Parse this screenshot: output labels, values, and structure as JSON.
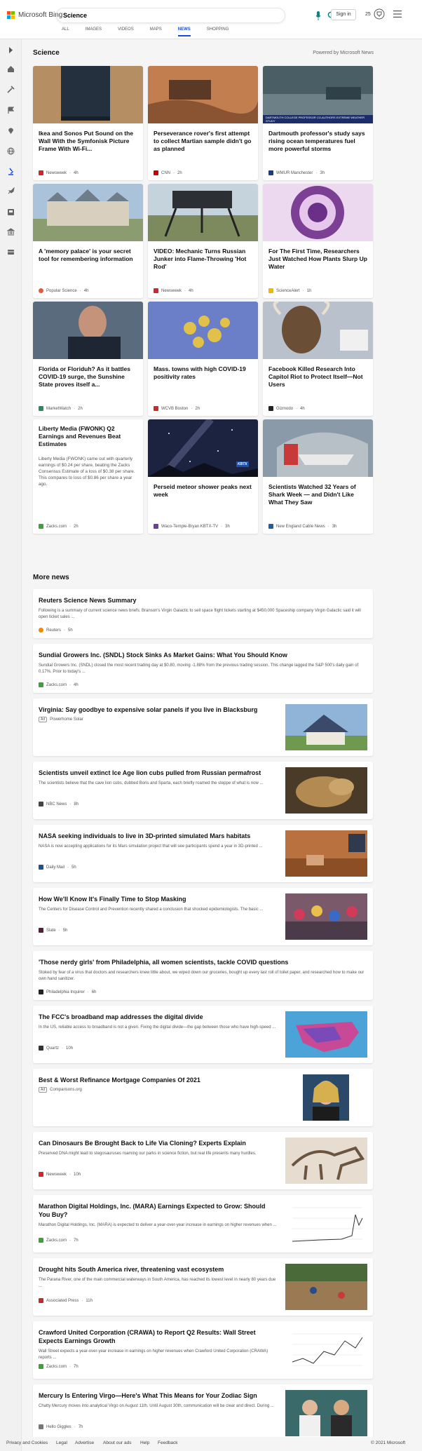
{
  "header": {
    "brand": "Microsoft Bing",
    "query": "Science",
    "tabs": [
      {
        "label": "ALL",
        "active": false
      },
      {
        "label": "IMAGES",
        "active": false
      },
      {
        "label": "VIDEOS",
        "active": false
      },
      {
        "label": "MAPS",
        "active": false
      },
      {
        "label": "NEWS",
        "active": true
      },
      {
        "label": "SHOPPING",
        "active": false
      }
    ],
    "signin_label": "Sign in",
    "rewards_count": "25"
  },
  "science": {
    "heading": "Science",
    "powered_by": "Powered by Microsoft News",
    "cards": [
      {
        "title": "Ikea and Sonos Put Sound on the Wall With the Symfonisk Picture Frame With Wi-Fi...",
        "source": "Newsweek",
        "age": "4h"
      },
      {
        "title": "Perseverance rover's first attempt to collect Martian sample didn't go as planned",
        "source": "CNN",
        "age": "2h"
      },
      {
        "title": "Dartmouth professor's study says rising ocean temperatures fuel more powerful storms",
        "source": "WMUR Manchester",
        "age": "3h",
        "image_caption": "DARTMOUTH COLLEGE PROFESSOR CO-AUTHORS EXTREME WEATHER STUDY"
      },
      {
        "title": "A 'memory palace' is your secret tool for remembering information",
        "source": "Popular Science",
        "age": "4h"
      },
      {
        "title": "VIDEO: Mechanic Turns Russian Junker into Flame-Throwing 'Hot Rod'",
        "source": "Newsweek",
        "age": "4h"
      },
      {
        "title": "For The First Time, Researchers Just Watched How Plants Slurp Up Water",
        "source": "ScienceAlert",
        "age": "1h"
      },
      {
        "title": "Florida or Floriduh? As it battles COVID-19 surge, the Sunshine State proves itself a...",
        "source": "MarketWatch",
        "age": "2h"
      },
      {
        "title": "Mass. towns with high COVID-19 positivity rates",
        "source": "WCVB Boston",
        "age": "2h"
      },
      {
        "title": "Facebook Killed Research Into Capitol Riot to Protect Itself—Not Users",
        "source": "Gizmodo",
        "age": "4h"
      },
      {
        "title": "Liberty Media (FWONK) Q2 Earnings and Revenues Beat Estimates",
        "source": "Zacks.com",
        "age": "2h",
        "body": "Liberty Media (FWONK) came out with quarterly earnings of $0.24 per share, beating the Zacks Consensus Estimate of a loss of $0.38 per share. This compares to loss of $0.86 per share a year ago."
      },
      {
        "title": "Perseid meteor shower peaks next week",
        "source": "Waco-Temple-Bryan KBTX-TV",
        "age": "3h",
        "image_caption": "KBTX"
      },
      {
        "title": "Scientists Watched 32 Years of Shark Week — and Didn't Like What They Saw",
        "source": "New England Cable News",
        "age": "3h"
      }
    ]
  },
  "more_news": {
    "heading": "More news",
    "items": [
      {
        "title": "Reuters Science News Summary",
        "body": "Following is a summary of current science news briefs. Branson's Virgin Galactic to sell space flight tickets starting at $450,000 Spaceship company Virgin Galactic said it will open ticket sales ...",
        "source": "Reuters",
        "age": "5h"
      },
      {
        "title": "Sundial Growers Inc. (SNDL) Stock Sinks As Market Gains: What You Should Know",
        "body": "Sundial Growers Inc. (SNDL) closed the most recent trading day at $0.80, moving -1.88% from the previous trading session. This change lagged the S&P 500's daily gain of 0.17%. Prior to today's ...",
        "source": "Zacks.com",
        "age": "4h"
      },
      {
        "title": "Virginia: Say goodbye to expensive solar panels if you live in Blacksburg",
        "ad": "Ad",
        "source": "Powerhome Solar",
        "age": ""
      },
      {
        "title": "Scientists unveil extinct Ice Age lion cubs pulled from Russian permafrost",
        "body": "The scientists believe that the cave lion cubs, dubbed Boris and Sparta, each briefly roamed the steppe of what is now ...",
        "source": "NBC News",
        "age": "8h"
      },
      {
        "title": "NASA seeking individuals to live in 3D-printed simulated Mars habitats",
        "body": "NASA is now accepting applications for its Mars simulation project that will see participants spend a year in 3D-printed ...",
        "source": "Daily Mail",
        "age": "5h"
      },
      {
        "title": "How We'll Know It's Finally Time to Stop Masking",
        "body": "The Centers for Disease Control and Prevention recently shared a conclusion that shocked epidemiologists. The basic ...",
        "source": "Slate",
        "age": "5h"
      },
      {
        "title": "'Those nerdy girls' from Philadelphia, all women scientists, tackle COVID questions",
        "body": "Stoked by fear of a virus that doctors and researchers knew little about, we wiped down our groceries, bought up every last roll of toilet paper, and researched how to make our own hand sanitizer.",
        "source": "Philadelphia Inquirer",
        "age": "6h"
      },
      {
        "title": "The FCC's broadband map addresses the digital divide",
        "body": "In the US, reliable access to broadband is not a given. Fixing the digital divide—the gap between those who have high-speed ...",
        "source": "Quartz",
        "age": "10h"
      },
      {
        "title": "Best & Worst Refinance Mortgage Companies Of 2021",
        "ad": "Ad",
        "source": "Comparisons.org",
        "age": ""
      },
      {
        "title": "Can Dinosaurs Be Brought Back to Life Via Cloning? Experts Explain",
        "body": "Preserved DNA might lead to stegosauruses roaming our parks in science fiction, but real life presents many hurdles.",
        "source": "Newsweek",
        "age": "10h"
      },
      {
        "title": "Marathon Digital Holdings, Inc. (MARA) Earnings Expected to Grow: Should You Buy?",
        "body": "Marathon Digital Holdings, Inc. (MARA) is expected to deliver a year-over-year increase in earnings on higher revenues when ...",
        "source": "Zacks.com",
        "age": "7h"
      },
      {
        "title": "Drought hits South America river, threatening vast ecosystem",
        "body": "The Parana River, one of the main commercial waterways in South America, has reached its lowest level in nearly 80 years due ...",
        "source": "Associated Press",
        "age": "11h"
      },
      {
        "title": "Crawford United Corporation (CRAWA) to Report Q2 Results: Wall Street Expects Earnings Growth",
        "body": "Wall Street expects a year-over-year increase in earnings on higher revenues when Crawford United Corporation (CRAWA) reports ...",
        "source": "Zacks.com",
        "age": "7h"
      },
      {
        "title": "Mercury Is Entering Virgo—Here's What This Means for Your Zodiac Sign",
        "body": "Chatty Mercury moves into analytical Virgo on August 11th. Until August 30th, communication will be clear and direct. During ...",
        "source": "Hello Giggles",
        "age": "7h"
      }
    ]
  },
  "footer": {
    "links": [
      "Privacy and Cookies",
      "Legal",
      "Advertise",
      "About our ads",
      "Help",
      "Feedback"
    ],
    "copyright": "© 2021 Microsoft"
  },
  "colors": {
    "accent": "#174ae4",
    "search_icon": "#0c8484"
  }
}
